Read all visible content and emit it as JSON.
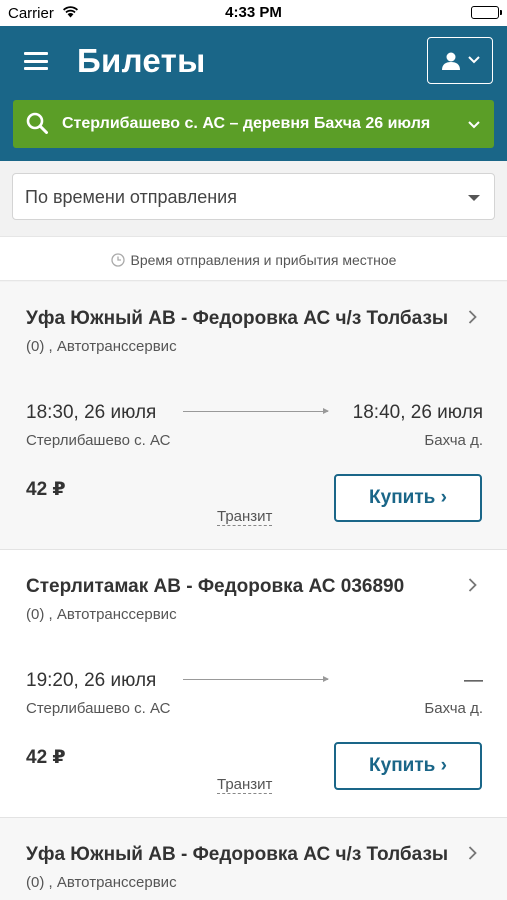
{
  "status_bar": {
    "carrier": "Carrier",
    "time": "4:33 PM"
  },
  "header": {
    "title": "Билеты",
    "route": "Стерлибашево с. АС – деревня Бахча  26 июля"
  },
  "sort": {
    "selected": "По времени отправления"
  },
  "notice": "Время отправления и прибытия местное",
  "trips": [
    {
      "title": "Уфа Южный АВ - Федоровка АС ч/з Толбазы",
      "carrier": "(0) , Автотранссервис",
      "dep_time": "18:30, 26 июля",
      "arr_time": "18:40, 26 июля",
      "dep_stop": "Стерлибашево с. АС",
      "arr_stop": "Бахча д.",
      "price": "42 ₽",
      "transit": "Транзит",
      "buy": "Купить ›"
    },
    {
      "title": "Стерлитамак АВ - Федоровка АС 036890",
      "carrier": "(0) , Автотранссервис",
      "dep_time": "19:20, 26 июля",
      "arr_time": "—",
      "dep_stop": "Стерлибашево с. АС",
      "arr_stop": "Бахча д.",
      "price": "42 ₽",
      "transit": "Транзит",
      "buy": "Купить ›"
    },
    {
      "title": "Уфа Южный АВ - Федоровка АС ч/з Толбазы",
      "carrier": "(0) , Автотранссервис"
    }
  ]
}
